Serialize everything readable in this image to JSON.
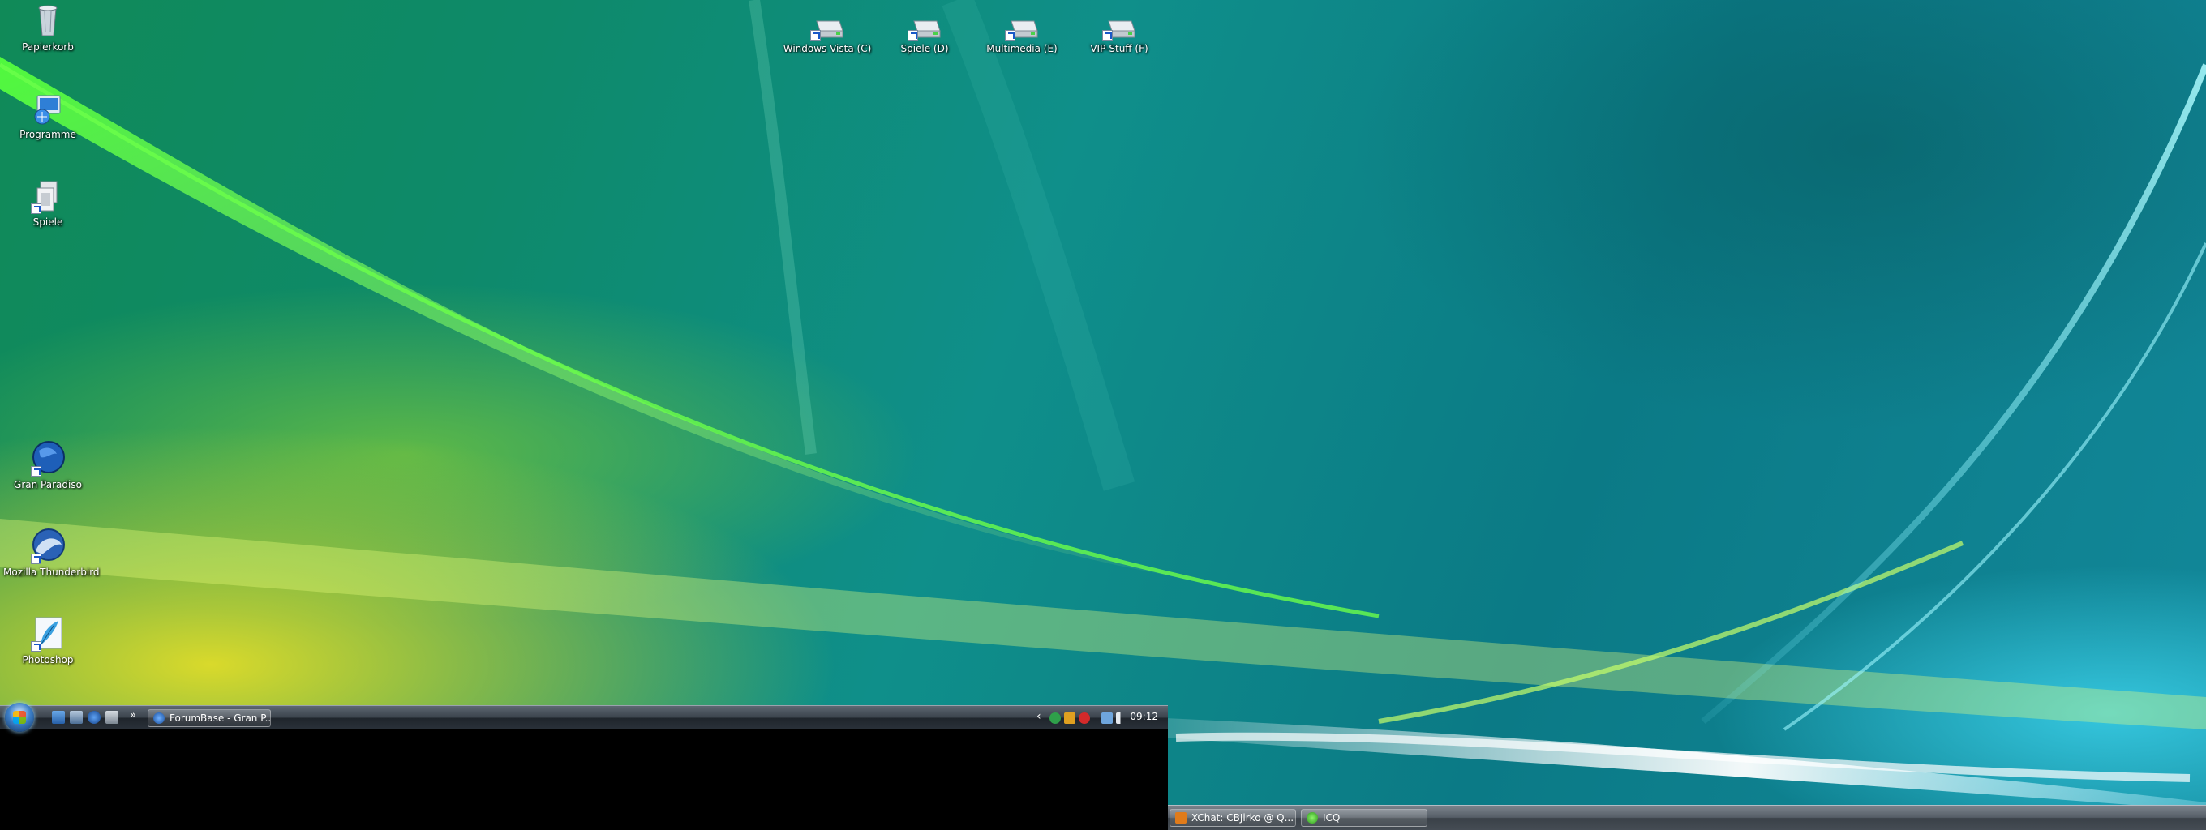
{
  "desktop": {
    "left_icons": [
      {
        "label": "Papierkorb",
        "icon": "recycle-bin-icon"
      },
      {
        "label": "Programme",
        "icon": "programs-folder-icon"
      },
      {
        "label": "Spiele",
        "icon": "games-folder-icon"
      },
      {
        "label": "Gran Paradiso",
        "icon": "gran-paradiso-globe-icon"
      },
      {
        "label": "Mozilla Thunderbird",
        "icon": "thunderbird-icon"
      },
      {
        "label": "Photoshop",
        "icon": "photoshop-feather-icon"
      }
    ],
    "drive_icons": [
      {
        "label": "Windows Vista (C)",
        "icon": "drive-icon"
      },
      {
        "label": "Spiele (D)",
        "icon": "drive-icon"
      },
      {
        "label": "Multimedia (E)",
        "icon": "drive-icon"
      },
      {
        "label": "VIP-Stuff (F)",
        "icon": "drive-icon"
      }
    ]
  },
  "taskbar_primary": {
    "quicklaunch": [
      "show-desktop-icon",
      "switch-windows-icon",
      "browser-globe-icon",
      "media-icon"
    ],
    "overflow_label": "»",
    "window_button": "ForumBase - Gran P...",
    "tray_toggle": "‹",
    "clock": "09:12"
  },
  "taskbar_secondary": {
    "buttons": [
      {
        "label": "XChat: CBJirko @ Q...",
        "icon": "xchat-icon"
      },
      {
        "label": "ICQ",
        "icon": "icq-flower-icon"
      }
    ]
  },
  "colors": {
    "taskbar": "#3b434c",
    "accent": "#1a58c8"
  }
}
